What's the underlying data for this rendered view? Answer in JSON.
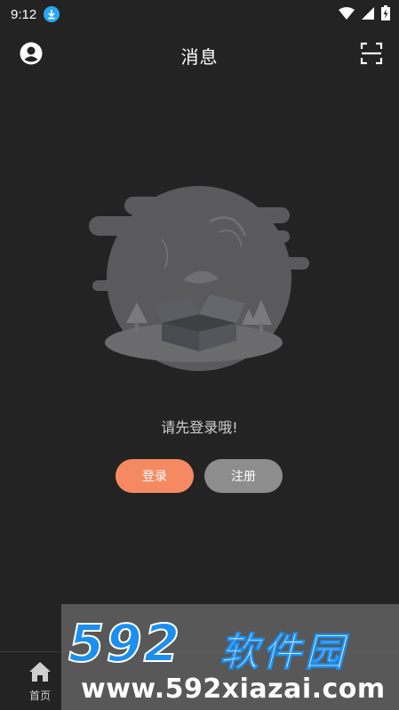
{
  "status_bar": {
    "time": "9:12",
    "icons": [
      "download-badge-icon",
      "wifi-icon",
      "signal-icon",
      "battery-charging-icon"
    ]
  },
  "header": {
    "title": "消息",
    "left_icon": "user-avatar-icon",
    "right_icon": "scan-icon"
  },
  "empty_state": {
    "illustration": "empty-box-illustration",
    "message": "请先登录哦!"
  },
  "actions": {
    "login_label": "登录",
    "register_label": "注册"
  },
  "bottom_nav": {
    "items": [
      {
        "icon": "home-icon",
        "label": "首页"
      }
    ]
  },
  "watermark": {
    "logo_number": "592",
    "logo_text": "软件园",
    "url": "www.592xiazai.com"
  },
  "colors": {
    "background": "#232323",
    "login_button": "#f58a62",
    "register_button": "#8d8d8d",
    "badge_blue": "#2aa8f2"
  }
}
